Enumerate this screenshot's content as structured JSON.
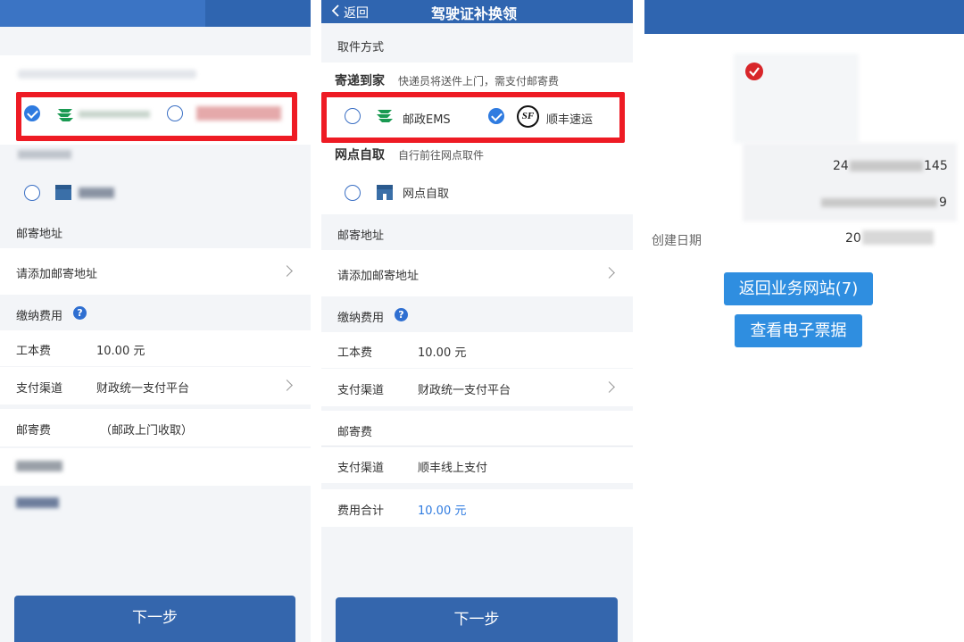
{
  "left": {
    "mail_address_section": "邮寄地址",
    "add_address": "请添加邮寄地址",
    "fee_section": "缴纳费用",
    "fee_help": "?",
    "labor_fee_label": "工本费",
    "labor_fee_value": "10.00 元",
    "pay_channel_label": "支付渠道",
    "pay_channel_value": "财政统一支付平台",
    "postage_label": "邮寄费",
    "postage_value": "（邮政上门收取）",
    "next_button": "下一步"
  },
  "middle": {
    "back": "返回",
    "title": "驾驶证补换领",
    "pickup_method_section": "取件方式",
    "home_delivery_title": "寄递到家",
    "home_delivery_desc": "快递员将送件上门，需支付邮寄费",
    "ems_label": "邮政EMS",
    "sf_label": "顺丰速运",
    "sf_logo_text": "SF",
    "outlet_pickup_title": "网点自取",
    "outlet_pickup_desc": "自行前往网点取件",
    "outlet_option_label": "网点自取",
    "mail_address_section": "邮寄地址",
    "add_address": "请添加邮寄地址",
    "fee_section": "缴纳费用",
    "fee_help": "?",
    "labor_fee_label": "工本费",
    "labor_fee_value": "10.00 元",
    "pay_channel_label": "支付渠道",
    "pay_channel_value": "财政统一支付平台",
    "postage_section": "邮寄费",
    "postage_channel_label": "支付渠道",
    "postage_channel_value": "顺丰线上支付",
    "total_label": "费用合计",
    "total_value": "10.00 元",
    "next_button": "下一步",
    "selected_option": "顺丰速运"
  },
  "right": {
    "partial_number_1": "24",
    "partial_number_1_tail": "145",
    "partial_number_2_tail": "9",
    "created_date_label": "创建日期",
    "created_date_value": "20",
    "return_button": "返回业务网站(7)",
    "view_receipt_button": "查看电子票据"
  },
  "colors": {
    "header_blue": "#2f65b0",
    "button_blue": "#3466ad",
    "highlight_red": "#ee1b24",
    "radio_blue": "#2f7be0",
    "ems_green": "#1a9a52",
    "link_blue": "#2f8ee0"
  },
  "icons": [
    "check-icon",
    "ems-logo-icon",
    "sf-logo-icon",
    "outlet-icon",
    "chevron-right-icon",
    "help-icon",
    "back-chevron-icon",
    "success-check-icon"
  ]
}
